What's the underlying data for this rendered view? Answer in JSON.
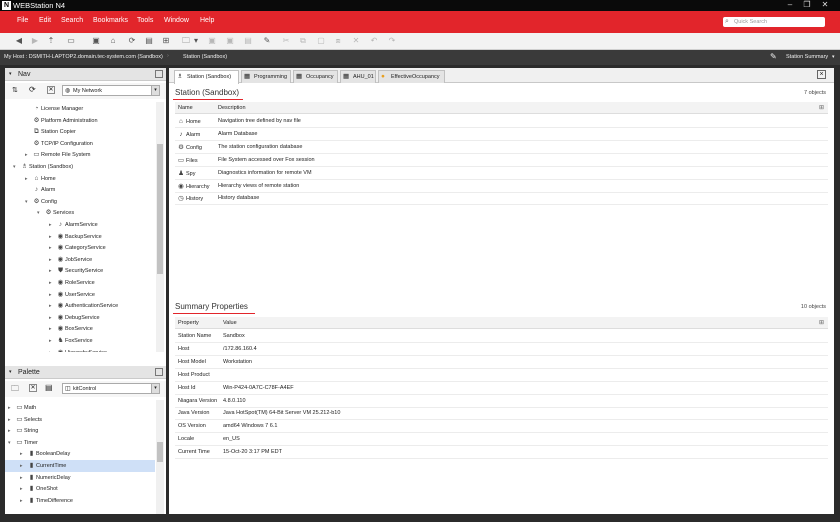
{
  "window": {
    "logo": "N",
    "title": "WEBStation N4"
  },
  "menu": [
    "File",
    "Edit",
    "Search",
    "Bookmarks",
    "Tools",
    "Window",
    "Help"
  ],
  "search": {
    "placeholder": "Quick Search"
  },
  "pathbar": {
    "host": "My Host : DSMITH-LAPTOP2.domain.tec-system.com (Sandbox)",
    "station": "Station (Sandbox)",
    "view": "Station Summary"
  },
  "nav": {
    "title": "Nav",
    "network": "My Network",
    "tree": [
      {
        "label": "License Manager",
        "icon": "license-icon",
        "depth": 1,
        "expander": ""
      },
      {
        "label": "Platform Administration",
        "icon": "platform-icon",
        "depth": 1,
        "expander": ""
      },
      {
        "label": "Station Copier",
        "icon": "copier-icon",
        "depth": 1,
        "expander": ""
      },
      {
        "label": "TCP/IP Configuration",
        "icon": "tcpip-icon",
        "depth": 1,
        "expander": ""
      },
      {
        "label": "Remote File System",
        "icon": "folder-icon",
        "depth": 1,
        "expander": "▸"
      },
      {
        "label": "Station (Sandbox)",
        "icon": "station-icon",
        "depth": 0,
        "expander": "▾"
      },
      {
        "label": "Home",
        "icon": "home-icon",
        "depth": 1,
        "expander": "▸"
      },
      {
        "label": "Alarm",
        "icon": "bell-icon",
        "depth": 1,
        "expander": ""
      },
      {
        "label": "Config",
        "icon": "config-icon",
        "depth": 1,
        "expander": "▾"
      },
      {
        "label": "Services",
        "icon": "services-icon",
        "depth": 2,
        "expander": "▾"
      },
      {
        "label": "AlarmService",
        "icon": "bell-icon",
        "depth": 3,
        "expander": "▸"
      },
      {
        "label": "BackupService",
        "icon": "backup-icon",
        "depth": 3,
        "expander": "▸"
      },
      {
        "label": "CategoryService",
        "icon": "category-icon",
        "depth": 3,
        "expander": "▸"
      },
      {
        "label": "JobService",
        "icon": "job-icon",
        "depth": 3,
        "expander": "▸"
      },
      {
        "label": "SecurityService",
        "icon": "shield-icon",
        "depth": 3,
        "expander": "▸"
      },
      {
        "label": "RoleService",
        "icon": "role-icon",
        "depth": 3,
        "expander": "▸"
      },
      {
        "label": "UserService",
        "icon": "user-icon",
        "depth": 3,
        "expander": "▸"
      },
      {
        "label": "AuthenticationService",
        "icon": "auth-icon",
        "depth": 3,
        "expander": "▸"
      },
      {
        "label": "DebugService",
        "icon": "debug-icon",
        "depth": 3,
        "expander": "▸"
      },
      {
        "label": "BoxService",
        "icon": "box-icon",
        "depth": 3,
        "expander": "▸"
      },
      {
        "label": "FoxService",
        "icon": "fox-icon",
        "depth": 3,
        "expander": "▸"
      },
      {
        "label": "HierarchyService",
        "icon": "hierarchy-icon",
        "depth": 3,
        "expander": "▸"
      }
    ]
  },
  "palette": {
    "title": "Palette",
    "module": "kitControl",
    "tree": [
      {
        "label": "Math",
        "icon": "folder-icon",
        "depth": 0,
        "expander": "▸"
      },
      {
        "label": "Selects",
        "icon": "folder-icon",
        "depth": 0,
        "expander": "▸"
      },
      {
        "label": "String",
        "icon": "folder-icon",
        "depth": 0,
        "expander": "▸"
      },
      {
        "label": "Timer",
        "icon": "folder-icon",
        "depth": 0,
        "expander": "▾"
      },
      {
        "label": "BooleanDelay",
        "icon": "block-icon",
        "depth": 1,
        "expander": "▸"
      },
      {
        "label": "CurrentTime",
        "icon": "block-icon",
        "depth": 1,
        "expander": "▸",
        "selected": true
      },
      {
        "label": "NumericDelay",
        "icon": "block-icon",
        "depth": 1,
        "expander": "▸"
      },
      {
        "label": "OneShot",
        "icon": "block-icon",
        "depth": 1,
        "expander": "▸"
      },
      {
        "label": "TimeDifference",
        "icon": "block-icon",
        "depth": 1,
        "expander": "▸"
      }
    ]
  },
  "tabs": [
    {
      "label": "Station (Sandbox)",
      "icon": "station-icon",
      "active": true
    },
    {
      "label": "Programming",
      "icon": "wiresheet-icon"
    },
    {
      "label": "Occupancy",
      "icon": "wiresheet-icon"
    },
    {
      "label": "AHU_01",
      "icon": "wiresheet-icon"
    },
    {
      "label": "EffectiveOccupancy",
      "icon": "occupancy-icon"
    }
  ],
  "station_table": {
    "title": "Station (Sandbox)",
    "count": "7 objects",
    "columns": [
      "Name",
      "Description"
    ],
    "rows": [
      {
        "name": "Home",
        "icon": "home-icon",
        "desc": "Navigation tree defined by nav file"
      },
      {
        "name": "Alarm",
        "icon": "bell-icon",
        "desc": "Alarm Database"
      },
      {
        "name": "Config",
        "icon": "config-icon",
        "desc": "The station configuration database"
      },
      {
        "name": "Files",
        "icon": "folder-icon",
        "desc": "File System accessed over Fox session"
      },
      {
        "name": "Spy",
        "icon": "spy-icon",
        "desc": "Diagnostics information for remote VM"
      },
      {
        "name": "Hierarchy",
        "icon": "hierarchy-icon",
        "desc": "Hierarchy views of remote station"
      },
      {
        "name": "History",
        "icon": "history-icon",
        "desc": "History database"
      }
    ]
  },
  "summary": {
    "title": "Summary Properties",
    "count": "10 objects",
    "columns": [
      "Property",
      "Value"
    ],
    "rows": [
      {
        "name": "Station Name",
        "value": "Sandbox"
      },
      {
        "name": "Host",
        "value": "/172.86.160.4"
      },
      {
        "name": "Host Model",
        "value": "Workstation"
      },
      {
        "name": "Host Product",
        "value": ""
      },
      {
        "name": "Host Id",
        "value": "Win-P424-0A7C-C78F-A4EF"
      },
      {
        "name": "Niagara Version",
        "value": "4.8.0.110"
      },
      {
        "name": "Java Version",
        "value": "Java HotSpot(TM) 64-Bit Server VM 25.212-b10"
      },
      {
        "name": "OS Version",
        "value": "amd64 Windows 7 6.1"
      },
      {
        "name": "Locale",
        "value": "en_US"
      },
      {
        "name": "Current Time",
        "value": "15-Oct-20 3:17 PM EDT"
      }
    ]
  }
}
